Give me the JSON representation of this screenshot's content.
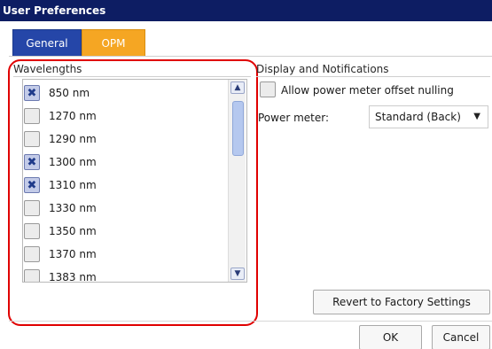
{
  "window": {
    "title": "User Preferences"
  },
  "tabs": [
    {
      "label": "General",
      "active": false
    },
    {
      "label": "OPM",
      "active": true
    }
  ],
  "wavelengths": {
    "title": "Wavelengths",
    "items": [
      {
        "label": "850 nm",
        "checked": true
      },
      {
        "label": "1270 nm",
        "checked": false
      },
      {
        "label": "1290 nm",
        "checked": false
      },
      {
        "label": "1300 nm",
        "checked": true
      },
      {
        "label": "1310 nm",
        "checked": true
      },
      {
        "label": "1330 nm",
        "checked": false
      },
      {
        "label": "1350 nm",
        "checked": false
      },
      {
        "label": "1370 nm",
        "checked": false
      },
      {
        "label": "1383 nm",
        "checked": false
      }
    ]
  },
  "display": {
    "title": "Display and Notifications",
    "offset_label": "Allow power meter offset nulling",
    "offset_checked": false,
    "power_meter_label": "Power meter:",
    "power_meter_value": "Standard (Back)"
  },
  "buttons": {
    "revert": "Revert to Factory Settings",
    "ok": "OK",
    "cancel": "Cancel"
  },
  "colors": {
    "title_bar": "#0d1d63",
    "tab_general": "#2546a8",
    "tab_opm": "#f5a623",
    "highlight": "#e00000"
  }
}
